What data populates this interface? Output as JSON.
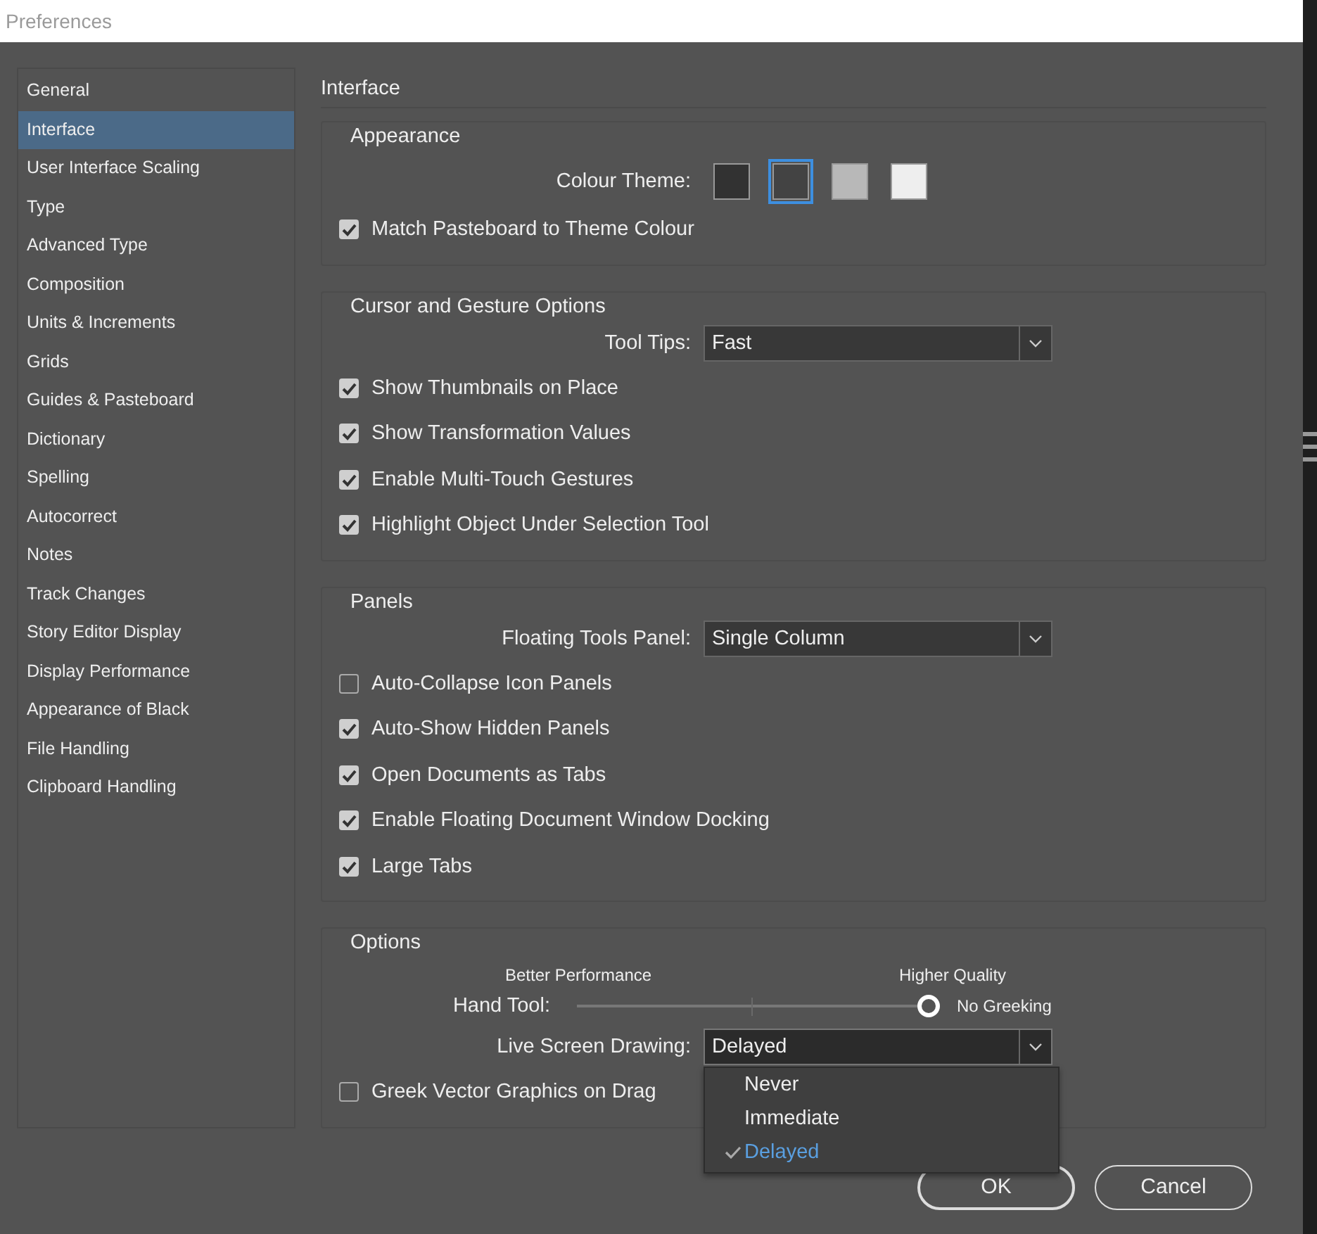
{
  "window": {
    "title": "Preferences"
  },
  "sidebar": {
    "items": [
      {
        "label": "General",
        "selected": false
      },
      {
        "label": "Interface",
        "selected": true
      },
      {
        "label": "User Interface Scaling",
        "selected": false
      },
      {
        "label": "Type",
        "selected": false
      },
      {
        "label": "Advanced Type",
        "selected": false
      },
      {
        "label": "Composition",
        "selected": false
      },
      {
        "label": "Units & Increments",
        "selected": false
      },
      {
        "label": "Grids",
        "selected": false
      },
      {
        "label": "Guides & Pasteboard",
        "selected": false
      },
      {
        "label": "Dictionary",
        "selected": false
      },
      {
        "label": "Spelling",
        "selected": false
      },
      {
        "label": "Autocorrect",
        "selected": false
      },
      {
        "label": "Notes",
        "selected": false
      },
      {
        "label": "Track Changes",
        "selected": false
      },
      {
        "label": "Story Editor Display",
        "selected": false
      },
      {
        "label": "Display Performance",
        "selected": false
      },
      {
        "label": "Appearance of Black",
        "selected": false
      },
      {
        "label": "File Handling",
        "selected": false
      },
      {
        "label": "Clipboard Handling",
        "selected": false
      }
    ]
  },
  "page_title": "Interface",
  "groups": [
    {
      "title": "Appearance",
      "rows": [
        {
          "kind": "swatches",
          "label": "Colour Theme:",
          "swatches": [
            {
              "color": "#323232",
              "selected": false
            },
            {
              "color": "#434343",
              "selected": true
            },
            {
              "color": "#b8b8b8",
              "selected": false
            },
            {
              "color": "#eeeeee",
              "selected": false
            }
          ]
        },
        {
          "kind": "checkbox",
          "label": "Match Pasteboard to Theme Colour",
          "checked": true
        }
      ]
    },
    {
      "title": "Cursor and Gesture Options",
      "rows": [
        {
          "kind": "select",
          "label": "Tool Tips:",
          "value": "Fast",
          "expanded": false
        },
        {
          "kind": "checkbox",
          "label": "Show Thumbnails on Place",
          "checked": true
        },
        {
          "kind": "checkbox",
          "label": "Show Transformation Values",
          "checked": true
        },
        {
          "kind": "checkbox",
          "label": "Enable Multi-Touch Gestures",
          "checked": true
        },
        {
          "kind": "checkbox",
          "label": "Highlight Object Under Selection Tool",
          "checked": true
        }
      ]
    },
    {
      "title": "Panels",
      "rows": [
        {
          "kind": "select",
          "label": "Floating Tools Panel:",
          "value": "Single Column",
          "expanded": false
        },
        {
          "kind": "checkbox",
          "label": "Auto-Collapse Icon Panels",
          "checked": false
        },
        {
          "kind": "checkbox",
          "label": "Auto-Show Hidden Panels",
          "checked": true
        },
        {
          "kind": "checkbox",
          "label": "Open Documents as Tabs",
          "checked": true
        },
        {
          "kind": "checkbox",
          "label": "Enable Floating Document Window Docking",
          "checked": true
        },
        {
          "kind": "checkbox",
          "label": "Large Tabs",
          "checked": true
        }
      ]
    },
    {
      "title": "Options",
      "rows": [
        {
          "kind": "slider",
          "label": "Hand Tool:",
          "left_caption": "Better Performance",
          "right_caption": "Higher Quality",
          "value_label": "No Greeking",
          "level": 1
        },
        {
          "kind": "select",
          "label": "Live Screen Drawing:",
          "value": "Delayed",
          "expanded": true,
          "options": [
            {
              "label": "Never",
              "selected": false
            },
            {
              "label": "Immediate",
              "selected": false
            },
            {
              "label": "Delayed",
              "selected": true
            }
          ]
        },
        {
          "kind": "checkbox",
          "label": "Greek Vector Graphics on Drag",
          "checked": false
        }
      ]
    }
  ],
  "buttons": [
    {
      "label": "OK",
      "kind": "default"
    },
    {
      "label": "Cancel",
      "kind": "normal"
    }
  ]
}
